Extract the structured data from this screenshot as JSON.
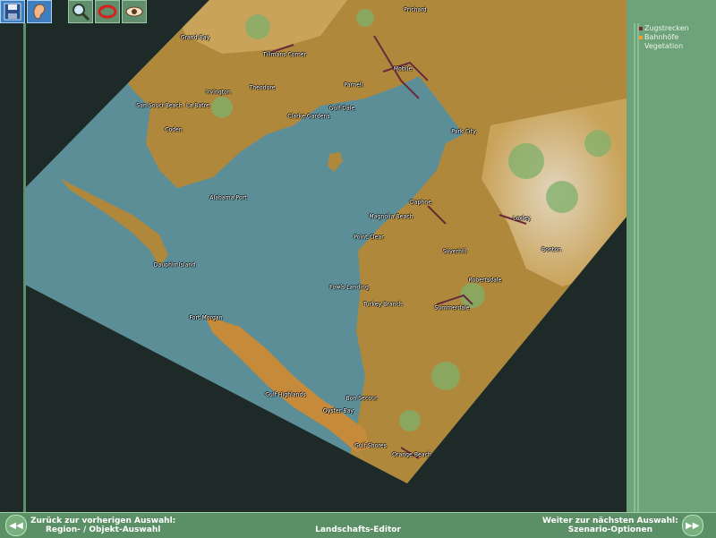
{
  "toolbar": {
    "buttons": [
      {
        "icon": "disk-icon"
      },
      {
        "icon": "ear-icon"
      },
      {
        "icon": "magnifier-icon"
      },
      {
        "icon": "rotate-icon"
      },
      {
        "icon": "eye-icon"
      }
    ],
    "right_buttons": [
      {
        "icon": "train-icon"
      },
      {
        "icon": "flower-icon"
      },
      {
        "icon": "track-icon"
      },
      {
        "icon": "building-icon"
      }
    ]
  },
  "legend": {
    "items": [
      {
        "label": "Zugstrecken",
        "color": "#7a2330"
      },
      {
        "label": "Bahnhöfe",
        "color": "#f0a030"
      },
      {
        "label": "Vegetation",
        "color": "#6ea37a"
      }
    ]
  },
  "map": {
    "colors": {
      "water": "#5c8e97",
      "land": "#b0883c",
      "land_light": "#c9a35a",
      "sand": "#c58a3a",
      "hill": "#d9c7a4",
      "vegetation": "#7fb06a",
      "rail": "#6a2a3a",
      "dark_bg": "#1d2a28"
    },
    "towns": [
      {
        "name": "Prichard"
      },
      {
        "name": "Grand Bay"
      },
      {
        "name": "Tillmans Corner"
      },
      {
        "name": "Mobile"
      },
      {
        "name": "Parnell"
      },
      {
        "name": "Irvington"
      },
      {
        "name": "Theodore"
      },
      {
        "name": "San Souci Beach"
      },
      {
        "name": "La Batre"
      },
      {
        "name": "Gulf Dale"
      },
      {
        "name": "Clarke Gardens"
      },
      {
        "name": "Coden"
      },
      {
        "name": "Park City"
      },
      {
        "name": "Alabama Port"
      },
      {
        "name": "Daphne"
      },
      {
        "name": "Magnolia Beach"
      },
      {
        "name": "Loxley"
      },
      {
        "name": "Point Clear"
      },
      {
        "name": "Silverhill"
      },
      {
        "name": "Bonton"
      },
      {
        "name": "Dauphin Island"
      },
      {
        "name": "Robertsdale"
      },
      {
        "name": "Fowls Landing"
      },
      {
        "name": "Turkey Branch"
      },
      {
        "name": "Summerdale"
      },
      {
        "name": "Fort Morgan"
      },
      {
        "name": "Gulf Highlands"
      },
      {
        "name": "Bon Secour"
      },
      {
        "name": "Oyster Bay"
      },
      {
        "name": "Gulf Shores"
      },
      {
        "name": "Orange Beach"
      }
    ]
  },
  "bottom": {
    "prev_line1": "Zurück zur vorherigen Auswahl:",
    "prev_line2": "Region- / Objekt-Auswahl",
    "next_line1": "Weiter zur nächsten Auswahl:",
    "next_line2": "Szenario-Optionen",
    "title": "Landschafts-Editor"
  }
}
